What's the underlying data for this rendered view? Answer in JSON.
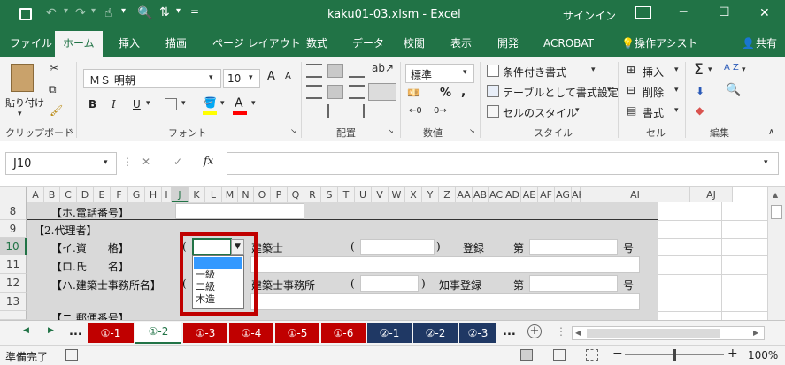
{
  "window": {
    "title": "kaku01-03.xlsm  -  Excel",
    "signin": "サインイン",
    "minimize": "─",
    "restore": "☐",
    "close": "✕",
    "redo_more": "="
  },
  "tabs": [
    "ファイル",
    "ホーム",
    "挿入",
    "描画",
    "ページ レイアウト",
    "数式",
    "データ",
    "校閲",
    "表示",
    "開発",
    "ACROBAT",
    "操作アシスト"
  ],
  "share": "共有",
  "ribbon": {
    "clipboard": {
      "label": "クリップボード",
      "paste": "貼り付け"
    },
    "font": {
      "label": "フォント",
      "name": "ＭＳ 明朝",
      "size": "10",
      "bold": "B",
      "italic": "I",
      "underline": "U",
      "grow": "A",
      "shrink": "A",
      "font_color": "A"
    },
    "alignment": {
      "label": "配置"
    },
    "number": {
      "label": "数値",
      "format": "標準",
      "percent": "%",
      "comma": ","
    },
    "styles": {
      "label": "スタイル",
      "conditional": "条件付き書式",
      "table": "テーブルとして書式設定",
      "cell": "セルのスタイル"
    },
    "cells": {
      "label": "セル",
      "insert": "挿入",
      "delete": "削除",
      "format": "書式"
    },
    "editing": {
      "label": "編集",
      "sum": "Σ",
      "sort": "A Z"
    }
  },
  "formula_bar": {
    "name_box": "J10",
    "cancel": "✕",
    "enter": "✓",
    "fx": "fx",
    "formula": ""
  },
  "columns": [
    "A",
    "B",
    "C",
    "D",
    "E",
    "F",
    "G",
    "H",
    "I",
    "J",
    "K",
    "L",
    "M",
    "N",
    "O",
    "P",
    "Q",
    "R",
    "S",
    "T",
    "U",
    "V",
    "W",
    "X",
    "Y",
    "Z",
    "AA",
    "AB",
    "AC",
    "AD",
    "AE",
    "AF",
    "AG",
    "AH",
    "AI",
    "AJ"
  ],
  "selected_column": "J",
  "rows": [
    "8",
    "9",
    "10",
    "11",
    "12",
    "13"
  ],
  "selected_row": "10",
  "cells": {
    "r8_label": "【ホ.電話番号】",
    "r9_label": "【2.代理者】",
    "r10_label": "【イ.資　　格】",
    "r10_paren_open": "(",
    "r10_kenchikushi": "建築士",
    "r10_paren2": "(",
    "r10_paren_close": ")",
    "r10_toroku": "登録",
    "r10_dai": "第",
    "r10_go": "号",
    "r11_label": "【ロ.氏　　名】",
    "r12_label": "【ハ.建築士事務所名】",
    "r12_paren_open": "(",
    "r12_office": "建築士事務所",
    "r12_paren2": "(",
    "r12_paren_close": ")",
    "r12_chiji": "知事登録",
    "r12_dai": "第",
    "r12_go": "号",
    "r14_label": "【ニ.郵便番号】"
  },
  "dropdown": {
    "options": [
      "",
      "一級",
      "二級",
      "木造"
    ]
  },
  "sheet_tabs": {
    "more": "...",
    "tabs": [
      "①-1",
      "①-2",
      "①-3",
      "①-4",
      "①-5",
      "①-6",
      "②-1",
      "②-2",
      "②-3"
    ],
    "more_right": "...",
    "add": "+"
  },
  "status": {
    "text": "準備完了",
    "zoom": "100%",
    "zoom_minus": "−",
    "zoom_plus": "+"
  },
  "colors": {
    "excel_green": "#217346",
    "red_tab": "#c00000",
    "blue_tab": "#1f3864",
    "highlight": "#c00000"
  }
}
